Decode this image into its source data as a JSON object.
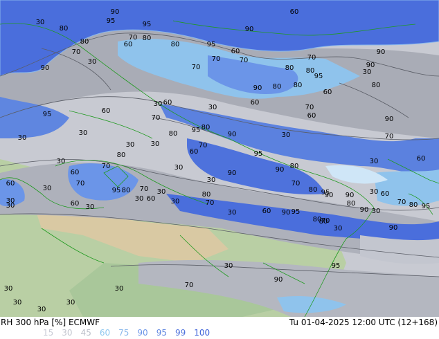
{
  "title_left": "RH 300 hPa [%] ECMWF",
  "title_right": "Tu 01-04-2025 12:00 UTC (12+168)",
  "legend": [
    {
      "value": "15",
      "color": "#c9ccd6"
    },
    {
      "value": "30",
      "color": "#c3c6cf"
    },
    {
      "value": "45",
      "color": "#bbbfc9"
    },
    {
      "value": "60",
      "color": "#8fc8f0"
    },
    {
      "value": "75",
      "color": "#8ab8ec"
    },
    {
      "value": "90",
      "color": "#6b95e8"
    },
    {
      "value": "95",
      "color": "#5f86e0"
    },
    {
      "value": "99",
      "color": "#4e72dc"
    },
    {
      "value": "100",
      "color": "#3a5fd8"
    }
  ],
  "contour_labels": [
    "90",
    "95",
    "95",
    "60",
    "30",
    "80",
    "80",
    "70",
    "60",
    "70",
    "80",
    "80",
    "90",
    "95",
    "60",
    "90",
    "80",
    "70",
    "30",
    "70",
    "70",
    "70",
    "80",
    "95",
    "90",
    "90",
    "30",
    "80",
    "80",
    "90",
    "80",
    "60",
    "60",
    "60",
    "95",
    "30",
    "60",
    "30",
    "70",
    "70",
    "60",
    "30",
    "80",
    "95",
    "80",
    "90",
    "60",
    "90",
    "30",
    "70",
    "30",
    "30",
    "30",
    "70",
    "60",
    "90",
    "30",
    "95",
    "80",
    "80",
    "70",
    "30",
    "60",
    "30",
    "70",
    "70",
    "95",
    "80",
    "90",
    "30",
    "90",
    "95",
    "80",
    "30",
    "60",
    "70",
    "60",
    "30",
    "80",
    "95",
    "90",
    "30",
    "30",
    "60",
    "70",
    "30",
    "70",
    "80",
    "30",
    "30",
    "30",
    "60",
    "30",
    "60",
    "80",
    "70",
    "30",
    "90",
    "95",
    "80",
    "90",
    "30",
    "90",
    "80",
    "30",
    "95",
    "90",
    "70",
    "30",
    "30",
    "30",
    "30",
    "30",
    "30",
    "30",
    "30",
    "30"
  ]
}
